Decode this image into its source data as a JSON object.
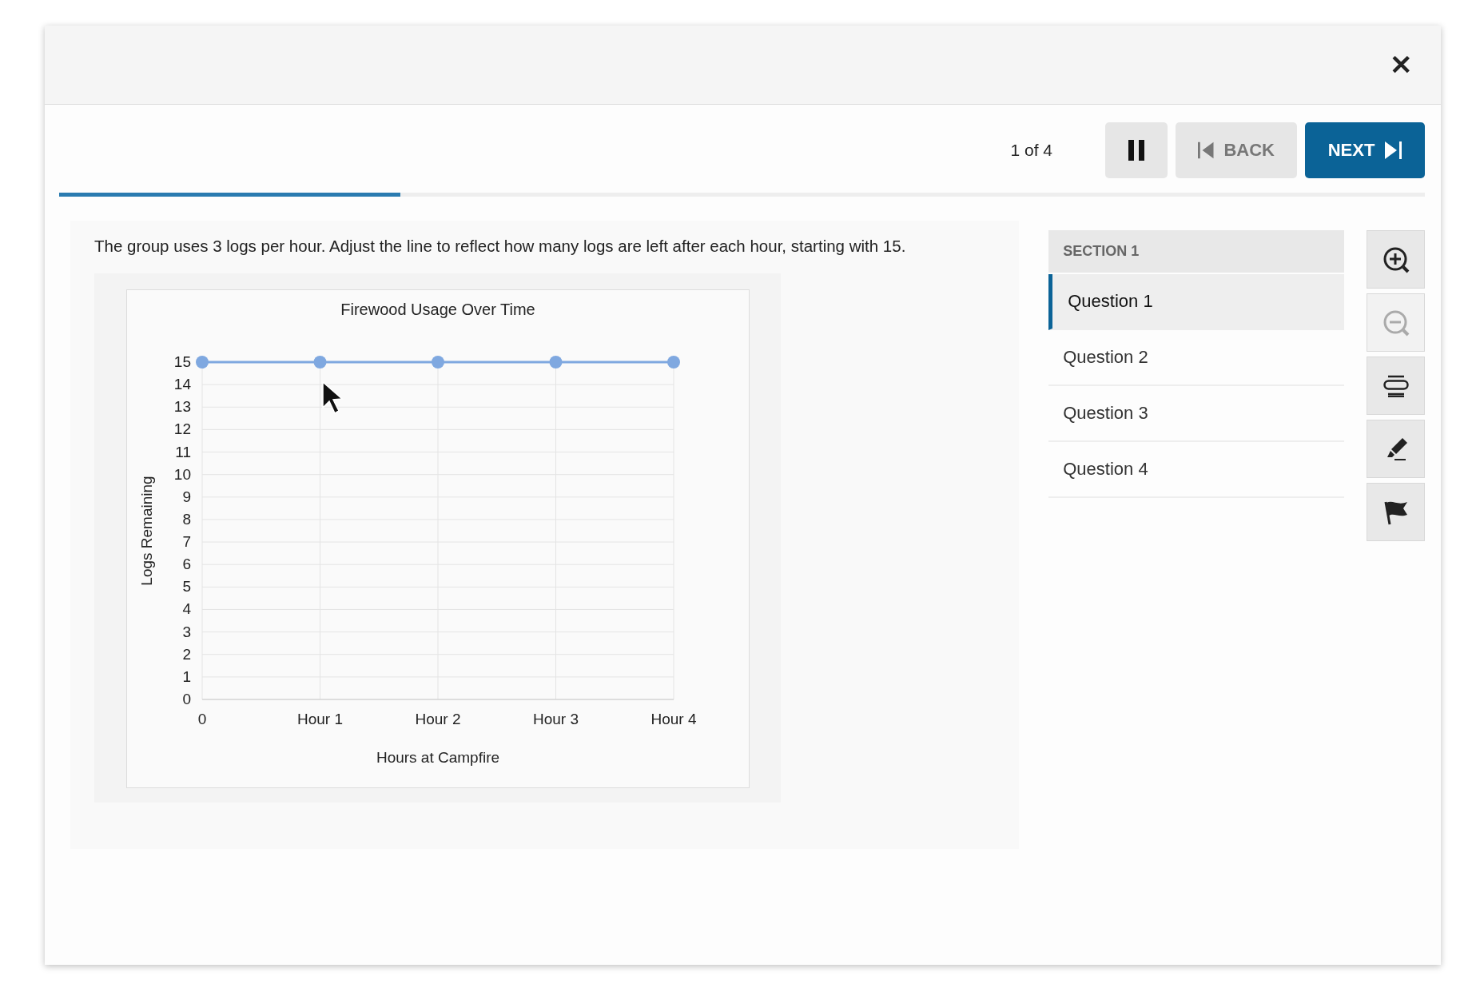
{
  "header": {
    "close_label": "✕"
  },
  "toolbar": {
    "counter": "1 of 4",
    "back_label": "BACK",
    "next_label": "NEXT"
  },
  "progress": {
    "level": 0.25
  },
  "question": {
    "prompt": "The group uses 3 logs per hour. Adjust the line to reflect how many logs are left after each hour, starting with 15.",
    "chart_data": {
      "type": "line",
      "title": "Firewood Usage Over Time",
      "xlabel": "Hours at Campfire",
      "ylabel": "Logs Remaining",
      "categories": [
        "0",
        "Hour 1",
        "Hour 2",
        "Hour 3",
        "Hour 4"
      ],
      "ylim": [
        0,
        15
      ],
      "yticks": [
        0,
        1,
        2,
        3,
        4,
        5,
        6,
        7,
        8,
        9,
        10,
        11,
        12,
        13,
        14,
        15
      ],
      "grid": true,
      "series": [
        {
          "color": "#7fa8e0",
          "marker": true,
          "values": [
            15,
            15,
            15,
            15,
            15
          ]
        }
      ]
    }
  },
  "sidebar": {
    "section": "SECTION 1",
    "items": [
      {
        "label": "Question 1",
        "selected": true
      },
      {
        "label": "Question 2",
        "selected": false
      },
      {
        "label": "Question 3",
        "selected": false
      },
      {
        "label": "Question 4",
        "selected": false
      }
    ]
  },
  "tools": [
    {
      "kind": "zoom-in",
      "disabled": false
    },
    {
      "kind": "zoom-out",
      "disabled": true
    },
    {
      "kind": "line-reader",
      "disabled": false
    },
    {
      "kind": "highlighter",
      "disabled": false
    },
    {
      "kind": "flag",
      "disabled": false
    }
  ]
}
